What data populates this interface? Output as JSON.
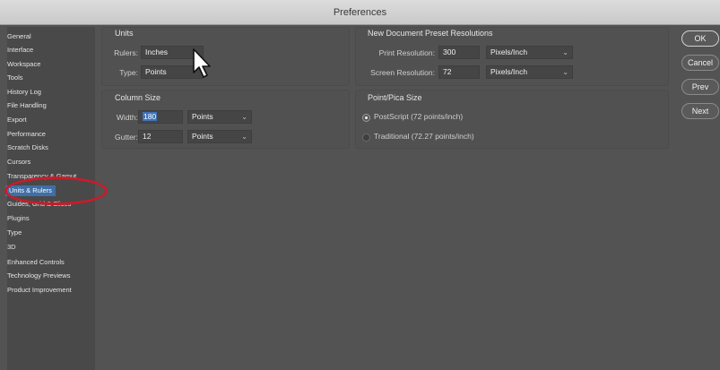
{
  "window": {
    "title": "Preferences"
  },
  "sidebar": {
    "items": [
      {
        "label": "General"
      },
      {
        "label": "Interface"
      },
      {
        "label": "Workspace"
      },
      {
        "label": "Tools"
      },
      {
        "label": "History Log"
      },
      {
        "label": "File Handling"
      },
      {
        "label": "Export"
      },
      {
        "label": "Performance"
      },
      {
        "label": "Scratch Disks"
      },
      {
        "label": "Cursors"
      },
      {
        "label": "Transparency & Gamut"
      },
      {
        "label": "Units & Rulers"
      },
      {
        "label": "Guides, Grid & Slices"
      },
      {
        "label": "Plugins"
      },
      {
        "label": "Type"
      },
      {
        "label": "3D"
      },
      {
        "label": "Enhanced Controls"
      },
      {
        "label": "Technology Previews"
      },
      {
        "label": "Product Improvement"
      }
    ],
    "active": "Units & Rulers"
  },
  "units": {
    "title": "Units",
    "rulers_label": "Rulers:",
    "rulers_value": "Inches",
    "type_label": "Type:",
    "type_value": "Points"
  },
  "column_size": {
    "title": "Column Size",
    "width_label": "Width:",
    "width_value": "180",
    "width_unit": "Points",
    "gutter_label": "Gutter:",
    "gutter_value": "12",
    "gutter_unit": "Points"
  },
  "new_doc": {
    "title": "New Document Preset Resolutions",
    "print_label": "Print Resolution:",
    "print_value": "300",
    "print_unit": "Pixels/Inch",
    "screen_label": "Screen Resolution:",
    "screen_value": "72",
    "screen_unit": "Pixels/Inch"
  },
  "point_pica": {
    "title": "Point/Pica Size",
    "postscript_label": "PostScript (72 points/inch)",
    "traditional_label": "Traditional (72.27 points/inch)",
    "selected": "PostScript (72 points/inch)"
  },
  "buttons": {
    "ok": "OK",
    "cancel": "Cancel",
    "prev": "Prev",
    "next": "Next"
  },
  "colors": {
    "background": "#535353",
    "selection": "#3f6fa7",
    "annotation": "#c81c2a"
  }
}
